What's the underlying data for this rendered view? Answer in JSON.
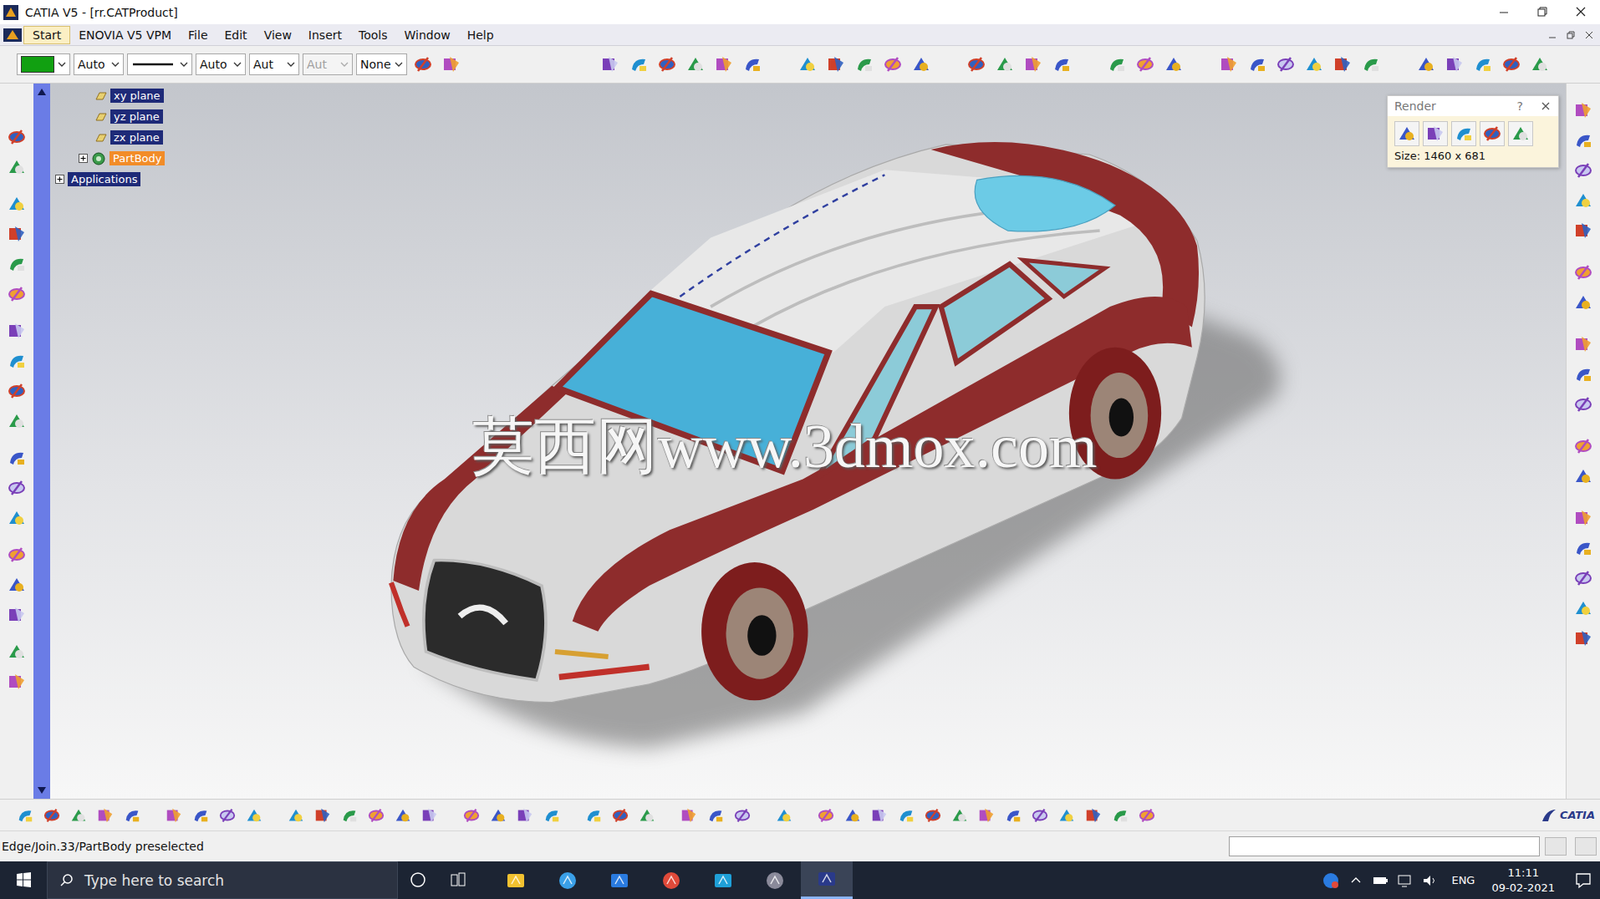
{
  "window": {
    "title": "CATIA V5 - [rr.CATProduct]"
  },
  "menu": [
    {
      "label": "Start",
      "selected": true
    },
    {
      "label": "ENOVIA V5 VPM",
      "selected": false
    },
    {
      "label": "File",
      "selected": false
    },
    {
      "label": "Edit",
      "selected": false
    },
    {
      "label": "View",
      "selected": false
    },
    {
      "label": "Insert",
      "selected": false
    },
    {
      "label": "Tools",
      "selected": false
    },
    {
      "label": "Window",
      "selected": false
    },
    {
      "label": "Help",
      "selected": false
    }
  ],
  "properties": [
    {
      "kind": "color",
      "color": "#11a011",
      "disabled": false
    },
    {
      "kind": "text",
      "label": "Auto",
      "disabled": false
    },
    {
      "kind": "line",
      "disabled": false
    },
    {
      "kind": "text",
      "label": "Auto",
      "disabled": false
    },
    {
      "kind": "text",
      "label": "Aut",
      "disabled": false
    },
    {
      "kind": "text",
      "label": "Aut",
      "disabled": true
    },
    {
      "kind": "text",
      "label": "None",
      "disabled": false
    }
  ],
  "tree": [
    {
      "label": "xy plane",
      "kind": "plane",
      "selected": true,
      "preselected": false
    },
    {
      "label": "yz plane",
      "kind": "plane",
      "selected": true,
      "preselected": false
    },
    {
      "label": "zx plane",
      "kind": "plane",
      "selected": true,
      "preselected": false
    },
    {
      "label": "PartBody",
      "kind": "body",
      "selected": false,
      "preselected": true,
      "expanded": false
    },
    {
      "label": "Applications",
      "kind": "node",
      "selected": true,
      "preselected": false,
      "expanded": false
    }
  ],
  "render_dialog": {
    "title": "Render",
    "help": "?",
    "size": "Size: 1460 x 681"
  },
  "watermark": "莫西网www.3dmox.com",
  "status_bar": {
    "message": "Edge/Join.33/PartBody preselected"
  },
  "brand": "CATIA",
  "taskbar": {
    "search_placeholder": "Type here to search",
    "language": "ENG",
    "time": "11:11",
    "date": "09-02-2021"
  }
}
